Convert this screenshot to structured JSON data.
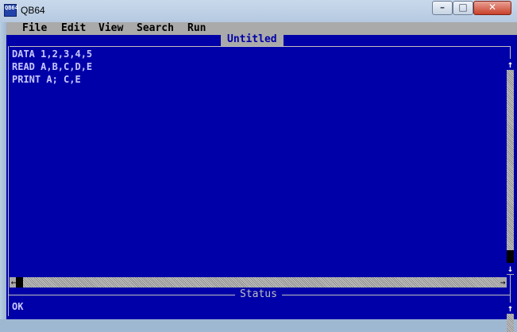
{
  "window": {
    "title": "QB64",
    "icon_label": "QB64",
    "controls": {
      "minimize": "–",
      "maximize": "□",
      "close": "✕"
    }
  },
  "menu": {
    "items": [
      "File",
      "Edit",
      "View",
      "Search",
      "Run"
    ]
  },
  "editor": {
    "title": "Untitled",
    "lines": [
      "DATA 1,2,3,4,5",
      "READ A,B,C,D,E",
      "PRINT A; C,E"
    ]
  },
  "scrollbar": {
    "up_arrow": "↑",
    "down_arrow": "↓",
    "left_arrow": "←",
    "right_arrow": "→"
  },
  "status": {
    "title": "Status",
    "text": "OK"
  },
  "colors": {
    "background": "#0000a8",
    "menu": "#aaaaaa",
    "text": "#c8c8ff"
  }
}
